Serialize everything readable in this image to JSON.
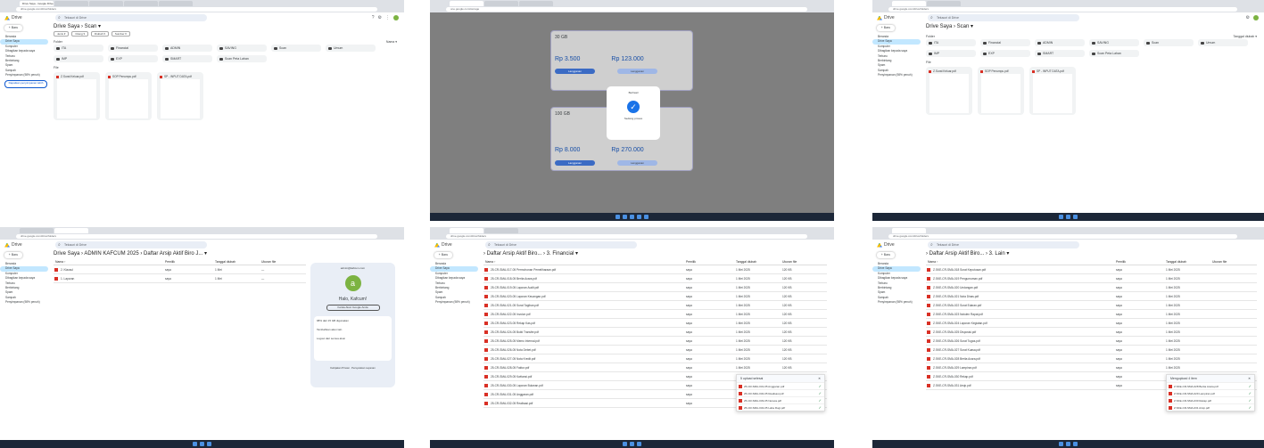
{
  "p1": {
    "tabs": [
      "Drive Saya - Google Drive",
      "",
      "",
      "",
      ""
    ],
    "addr": "drive.google.com/drive/folders",
    "brand": "Drive",
    "search": "Telusuri di Drive",
    "new": "+ Baru",
    "side": [
      "Beranda",
      "Drive Saya",
      "Komputer",
      "Dibagikan kepada saya",
      "Terbaru",
      "Berbintang",
      "Spam",
      "Sampah",
      "Penyimpanan (98% penuh)"
    ],
    "upgrade": "Dapatkan penyimpanan lebih",
    "crumb": "Drive Saya › Scan ▾",
    "chips": [
      "Jenis ▾",
      "Orang ▾",
      "Diubah ▾",
      "Sumber ▾"
    ],
    "fl": "Folder",
    "sort": "Nama ▾",
    "folders": [
      "ITA",
      "Financial",
      "ADMIN",
      "SAVING",
      "Scan",
      "Umum",
      "IMP",
      "EXP",
      "SMART",
      "Scan Peta Lahan"
    ],
    "filesl": "File",
    "files": [
      "Z.Surat Keluar.pdf",
      "SOP Penumpu.pdf",
      "SP - INPUT DATA.pdf"
    ]
  },
  "p2": {
    "addr": "one.google.com/storage",
    "plan1": "30 GB",
    "p1a": "Rp 3.500",
    "p1b": "Rp 123.000",
    "plan2": "100 GB",
    "p2a": "Rp 8.000",
    "p2b": "Rp 270.000",
    "dlgt": "Berhasil",
    "dlgm": "Sedang proses",
    "btn": "Langganan"
  },
  "p3": {
    "crumb": "Drive Saya › Scan ▾",
    "fl": "Folder",
    "sort": "Tanggal diubah ▾",
    "folders": [
      "ITA",
      "Financial",
      "ADMIN",
      "SAVING",
      "Scan",
      "Umum",
      "IMP",
      "EXP",
      "SMART",
      "Scan Peta Lahan"
    ],
    "filesl": "File",
    "files": [
      "Z.Surat Keluar.pdf",
      "SOP Penumpu.pdf",
      "SP - INPUT DATA.pdf"
    ]
  },
  "p4": {
    "crumb": "Drive Saya › ADMIN KAFCUM 2025 › Daftar Arsip Aktif Biro J... ▾",
    "cols": [
      "Nama ↑",
      "Pemilik",
      "Tanggal diubah",
      "Ukuran file"
    ],
    "rows": [
      [
        "2. Klausul",
        "saya",
        "1 Mei",
        "—"
      ],
      [
        "1. Laporan",
        "saya",
        "1 Mei",
        "—"
      ]
    ],
    "email": "admin@kafcum.com",
    "hello": "Halo, Kafcum!",
    "manage": "Kelola Akun Google Anda",
    "storage": "98% dari 15 GB digunakan",
    "accts": [
      "Tambahkan akun lain",
      "Logout dari semua akun"
    ],
    "priv": "Kebijakan Privasi · Persyaratan Layanan"
  },
  "p5": {
    "crumb": "› Daftar Arsip Aktif Biro... › 3. Financial ▾",
    "cols": [
      "Nama ↑",
      "Pemilik",
      "Tanggal diubah",
      "Ukuran file"
    ],
    "rows": [
      "25-CR-SMA-017-05 Permohonan Pemeliharaan.pdf",
      "25-CR-SMA-018-05 Berita Acara.pdf",
      "25-CR-SMA-019-05 Laporan Audit.pdf",
      "25-CR-SMA-020-05 Laporan Keuangan.pdf",
      "25-CR-SMA-021-05 Surat Tagihan.pdf",
      "25-CR-SMA-022-05 Invoice.pdf",
      "25-CR-SMA-023-05 Rekap Kas.pdf",
      "25-CR-SMA-024-05 Bukti Transfer.pdf",
      "25-CR-SMA-025-05 Memo Internal.pdf",
      "25-CR-SMA-026-05 Nota Debet.pdf",
      "25-CR-SMA-027-05 Nota Kredit.pdf",
      "25-CR-SMA-028-05 Faktur.pdf",
      "25-CR-SMA-029-05 Kwitansi.pdf",
      "25-CR-SMA-030-05 Laporan Bulanan.pdf",
      "25-CR-SMA-031-05 Anggaran.pdf",
      "25-CR-SMA-032-05 Realisasi.pdf"
    ],
    "owner": "saya",
    "date": "1 Mei 2025",
    "size": "120 KB",
    "upl": "5 upload selesai",
    "upf": [
      "25-CR-SMA-031-05 Anggaran.pdf",
      "25-CR-SMA-032-05 Realisasi.pdf",
      "25-CR-SMA-033-05 Neraca.pdf",
      "25-CR-SMA-034-05 Laba Rugi.pdf"
    ]
  },
  "p6": {
    "crumb": "› Daftar Arsip Aktif Biro... › 3. Lain ▾",
    "rows": [
      "Z.SKE-CR-SMA-018 Surat Keputusan.pdf",
      "Z.SKE-CR-SMA-019 Pengumuman.pdf",
      "Z.SKE-CR-SMA-020 Undangan.pdf",
      "Z.SKE-CR-SMA-021 Nota Dinas.pdf",
      "Z.SKE-CR-SMA-022 Surat Edaran.pdf",
      "Z.SKE-CR-SMA-023 Notulen Rapat.pdf",
      "Z.SKE-CR-SMA-024 Laporan Kegiatan.pdf",
      "Z.SKE-CR-SMA-025 Disposisi.pdf",
      "Z.SKE-CR-SMA-026 Surat Tugas.pdf",
      "Z.SKE-CR-SMA-027 Surat Kuasa.pdf",
      "Z.SKE-CR-SMA-028 Berita Acara.pdf",
      "Z.SKE-CR-SMA-029 Lampiran.pdf",
      "Z.SKE-CR-SMA-030 Rekap.pdf",
      "Z.SKE-CR-SMA-031 Arsip.pdf"
    ],
    "owner": "saya",
    "date": "1 Mei 2025",
    "upl": "Mengupload 4 item",
    "upf": [
      "Z.SKE-CR-SMA-028 Berita Acara.pdf",
      "Z.SKE-CR-SMA-029 Lampiran.pdf",
      "Z.SKE-CR-SMA-030 Rekap.pdf",
      "Z.SKE-CR-SMA-031 Arsip.pdf"
    ]
  }
}
